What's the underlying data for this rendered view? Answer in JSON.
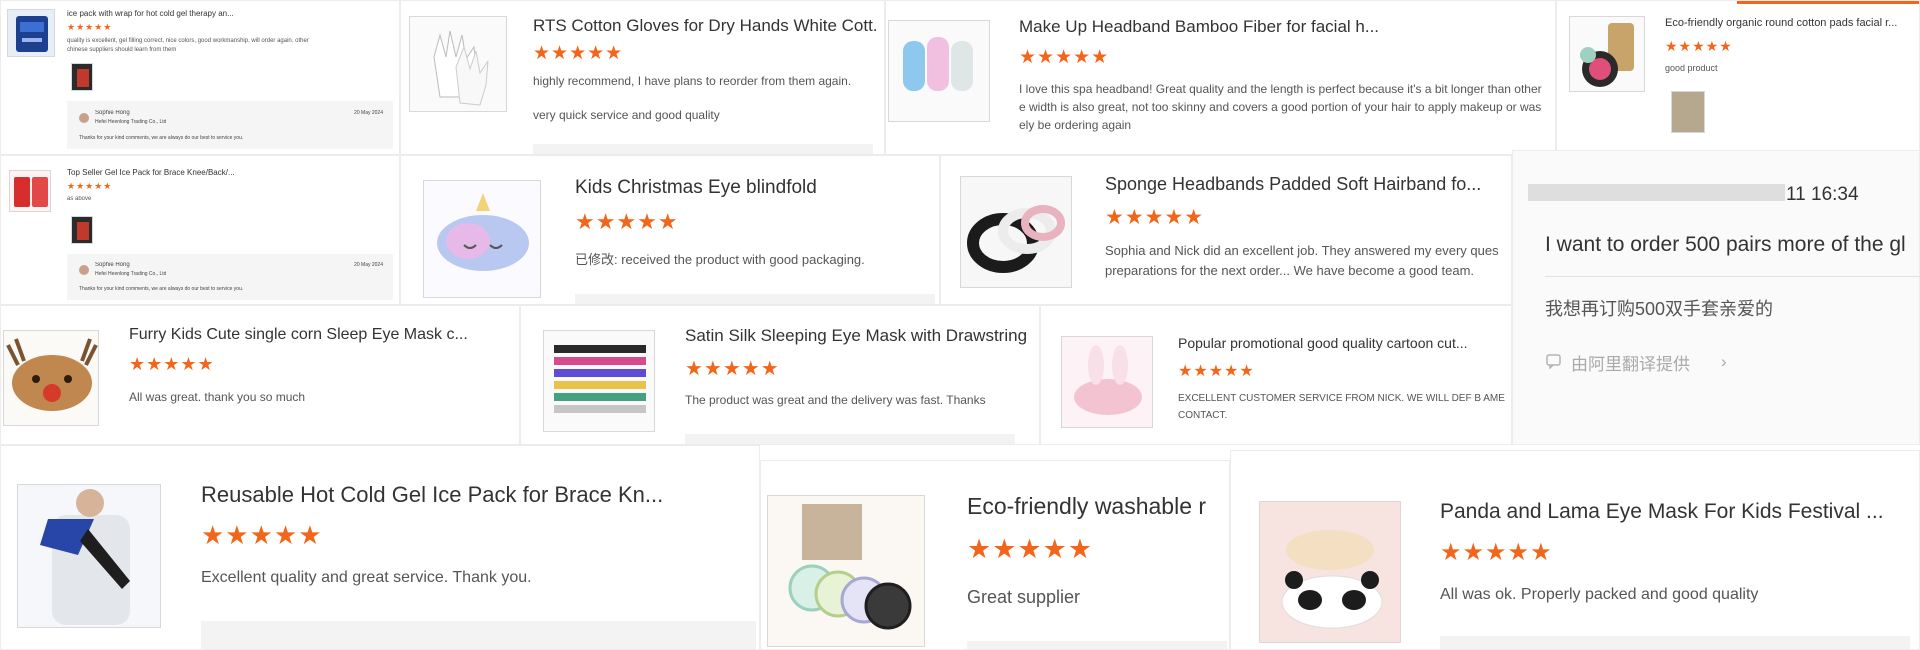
{
  "rating_glyphs": "★★★★★",
  "colors": {
    "star": "#f2661b",
    "text": "#333333",
    "review": "#555555",
    "reply_bg": "#f5f5f5",
    "chat_link": "#aaaaaa"
  },
  "cards": {
    "c1": {
      "title": "ice pack with wrap for hot cold gel therapy an...",
      "review": "quality is excellent, gel filling correct, nice colors, good workmanship, will order again. other chinese suppliers should learn from them",
      "reply_name": "Sophie Hong",
      "reply_company": "Hefei Heenlong Trading Co., Ltd",
      "reply_date": "20 May 2024",
      "reply_text": "Thanks for your kind comments, we are always do our best to service you."
    },
    "c2": {
      "title": "RTS Cotton Gloves for Dry Hands White Cott...",
      "review": "highly recommend, I have plans to reorder from them again.",
      "review2": "very quick service and good quality"
    },
    "c3": {
      "title": "Make Up Headband Bamboo Fiber for facial h...",
      "review": "I love this spa headband! Great quality and the length is perfect because it's a bit longer than other e width is also great, not too skinny and covers a good portion of your hair to apply makeup or was ely be ordering again"
    },
    "c4": {
      "title": "Eco-friendly organic round cotton pads facial r...",
      "review": "good product"
    },
    "c5": {
      "title": "Top Seller Gel Ice Pack for Brace Knee/Back/...",
      "review": "as above",
      "reply_name": "Sophie Hong",
      "reply_company": "Hefei Heenlong Trading Co., Ltd",
      "reply_date": "20 May 2024",
      "reply_text": "Thanks for your kind comments, we are always do our best to service you."
    },
    "c6": {
      "title": "Kids Christmas Eye blindfold",
      "review": "已修改: received the product with good packaging."
    },
    "c7": {
      "title": "Sponge Headbands Padded Soft Hairband fo...",
      "review": "Sophia and Nick did an excellent job. They answered my every ques preparations for the next order... We have become a good team."
    },
    "c8": {
      "timestamp": "11 16:34",
      "message": "I want to order 500 pairs more of the gl",
      "translation": "我想再订购500双手套亲爱的",
      "translate_link": "由阿里翻译提供"
    },
    "c9": {
      "title": "Furry Kids Cute single corn Sleep Eye Mask c...",
      "review": "All was great. thank you so much"
    },
    "c10": {
      "title": "Satin Silk Sleeping Eye Mask with Drawstring",
      "review": "The product was great and the delivery was fast. Thanks"
    },
    "c11": {
      "title": "Popular promotional good quality cartoon cut...",
      "review": "EXCELLENT CUSTOMER SERVICE FROM NICK. WE WILL DEF B AME CONTACT."
    },
    "c12": {
      "title": "Reusable Hot Cold Gel Ice Pack for Brace Kn...",
      "review": "Excellent quality and great service.  Thank you."
    },
    "c13": {
      "title": "Eco-friendly washable r",
      "review": "Great supplier"
    },
    "c14": {
      "title": "Panda and Lama Eye Mask For Kids Festival ...",
      "review": "All was ok. Properly packed and good quality"
    }
  }
}
